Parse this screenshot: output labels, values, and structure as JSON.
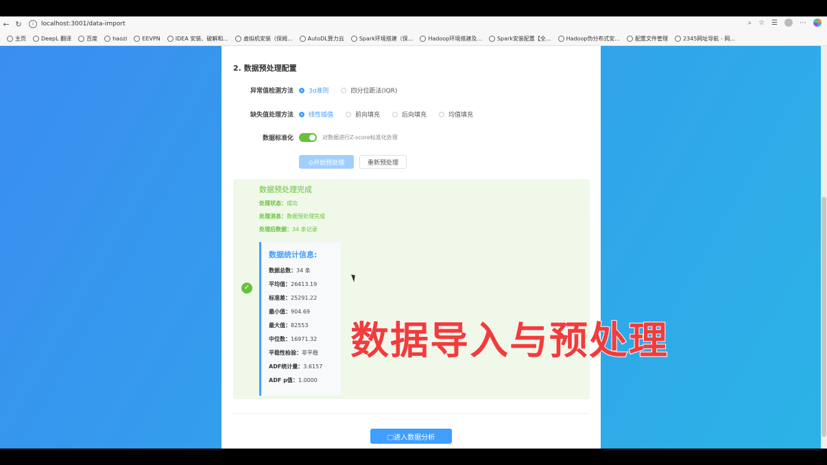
{
  "browser": {
    "url": "localhost:3001/data-import",
    "bookmarks": [
      "主页",
      "DeepL 翻译",
      "百度",
      "haozi",
      "EEVPN",
      "IDEA 安装、破解和...",
      "虚拟机安装（保姆...",
      "AutoDL算力云",
      "Spark环境搭建（保...",
      "Hadoop环境搭建及...",
      "Spark安装配置【全...",
      "Hadoop伪分布式安...",
      "配置文件管理",
      "2345网址导航 - 网..."
    ]
  },
  "config": {
    "section_title": "2. 数据预处理配置",
    "outlier_label": "异常值检测方法",
    "outlier_options": [
      "3σ准则",
      "四分位距法(IQR)"
    ],
    "missing_label": "缺失值处理方法",
    "missing_options": [
      "线性插值",
      "前向填充",
      "后向填充",
      "均值填充"
    ],
    "standardize_label": "数据标准化",
    "standardize_hint": "对数据进行Z-score标准化处理",
    "start_btn": "⊙开始预处理",
    "redo_btn": "重新预处理"
  },
  "result": {
    "title": "数据预处理完成",
    "status_label": "处理状态：",
    "status_value": "成功",
    "message_label": "处理消息：",
    "message_value": "数据预处理完成",
    "count_label": "处理后数据：",
    "count_value": "34 条记录",
    "stats_title": "数据统计信息:",
    "stats": [
      {
        "label": "数据总数：",
        "value": "34 条"
      },
      {
        "label": "平均值：",
        "value": "26413.19"
      },
      {
        "label": "标准差：",
        "value": "25291.22"
      },
      {
        "label": "最小值：",
        "value": "904.69"
      },
      {
        "label": "最大值：",
        "value": "82553"
      },
      {
        "label": "中位数：",
        "value": "16971.32"
      },
      {
        "label": "平稳性检验：",
        "value": "非平稳"
      },
      {
        "label": "ADF统计量：",
        "value": "3.6157"
      },
      {
        "label": "ADF p值：",
        "value": "1.0000"
      }
    ]
  },
  "go_btn": "🖵进入数据分析",
  "overlay_caption": "数据导入与预处理",
  "colors": {
    "primary": "#409eff",
    "success": "#67c23a",
    "caption": "#f23c3c"
  }
}
